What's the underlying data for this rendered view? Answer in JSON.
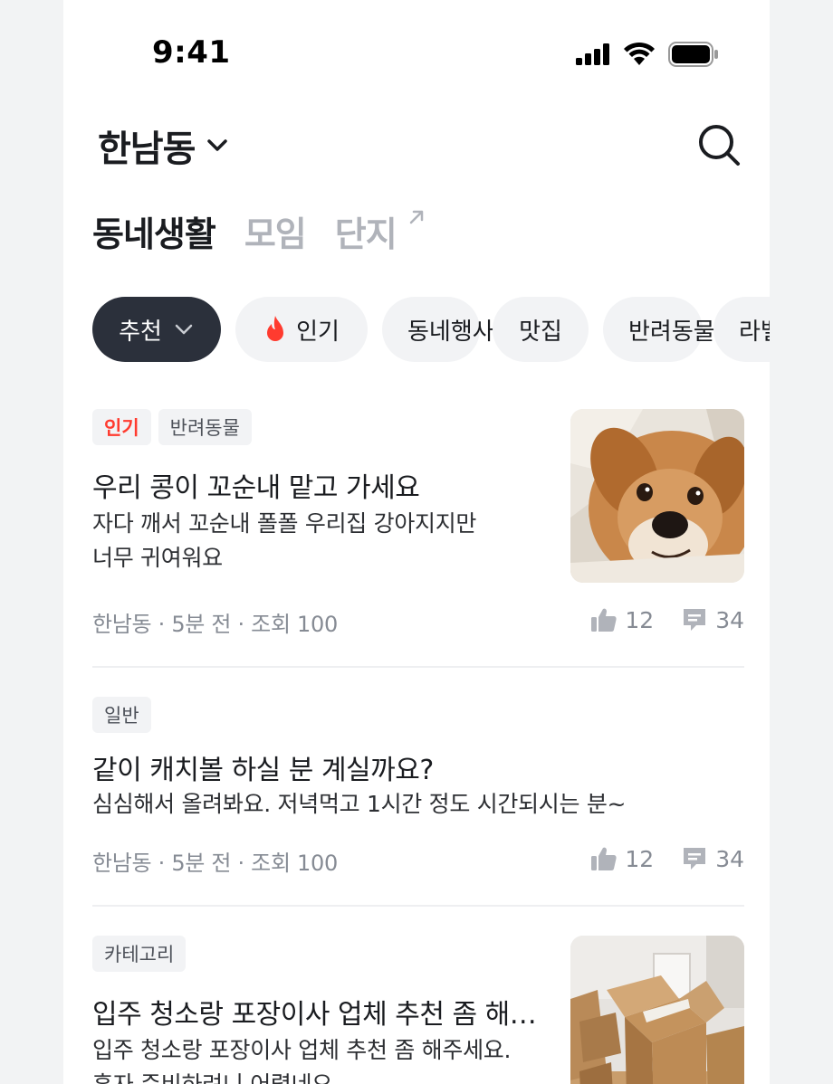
{
  "status_bar": {
    "time": "9:41"
  },
  "header": {
    "location": "한남동"
  },
  "tabs": [
    {
      "label": "동네생활",
      "active": true
    },
    {
      "label": "모임",
      "active": false
    },
    {
      "label": "단지",
      "active": false
    }
  ],
  "chips": [
    {
      "label": "추천",
      "active": true
    },
    {
      "label": "인기",
      "icon": "fire-icon"
    },
    {
      "label": "동네행사"
    },
    {
      "label": "맛집"
    },
    {
      "label": "반려동물"
    },
    {
      "label": "라벨"
    }
  ],
  "posts": [
    {
      "badges": [
        {
          "label": "인기",
          "style": "hot"
        },
        {
          "label": "반려동물"
        }
      ],
      "title": "우리 콩이 꼬순내 맡고 가세요",
      "body_lines": [
        "자다 깨서 꼬순내 폴폴 우리집 강아지지만",
        "너무 귀여워요"
      ],
      "meta": "한남동 · 5분 전 · 조회 100",
      "likes": "12",
      "comments": "34",
      "thumbnail": "dog-photo"
    },
    {
      "badges": [
        {
          "label": "일반"
        }
      ],
      "title": "같이 캐치볼 하실 분 계실까요?",
      "body_lines": [
        "심심해서 올려봐요. 저녁먹고 1시간 정도 시간되시는 분~"
      ],
      "meta": "한남동 · 5분 전 · 조회 100",
      "likes": "12",
      "comments": "34"
    },
    {
      "badges": [
        {
          "label": "카테고리"
        }
      ],
      "title": "입주 청소랑 포장이사 업체 추천 좀 해…",
      "body_lines": [
        "입주 청소랑 포장이사 업체 추천 좀 해주세요.",
        "혼자 준비하려니 어렵네요"
      ],
      "thumbnail": "moving-boxes-photo"
    }
  ],
  "colors": {
    "hot": "#ff3b2f",
    "active_chip": "#2b303b",
    "chip_bg": "#f2f3f5",
    "muted": "#868b94"
  }
}
